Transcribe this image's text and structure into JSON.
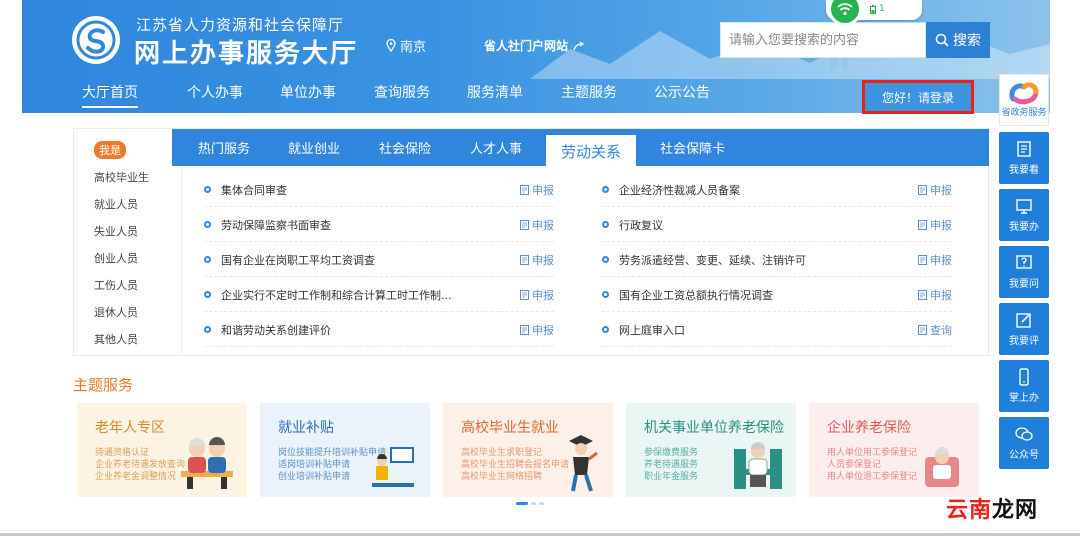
{
  "header": {
    "org_name": "江苏省人力资源和社会保障厅",
    "site_title": "网上办事服务大厅",
    "city": "南京",
    "portal_link": "省人社门户网站",
    "search": {
      "placeholder": "请输入您要搜索的内容",
      "button_label": "搜索"
    },
    "login_label": "您好！请登录"
  },
  "status_popup": {
    "battery_text": "1"
  },
  "nav": {
    "items": [
      {
        "label": "大厅首页",
        "active": true
      },
      {
        "label": "个人办事"
      },
      {
        "label": "单位办事"
      },
      {
        "label": "查询服务"
      },
      {
        "label": "服务清单"
      },
      {
        "label": "主题服务"
      },
      {
        "label": "公示公告"
      }
    ]
  },
  "side_bar": {
    "top_label": "省政务服务",
    "items": [
      {
        "label": "我要看",
        "icon": "book-icon"
      },
      {
        "label": "我要办",
        "icon": "monitor-icon"
      },
      {
        "label": "我要问",
        "icon": "question-icon"
      },
      {
        "label": "我要评",
        "icon": "edit-icon"
      },
      {
        "label": "掌上办",
        "icon": "phone-icon"
      },
      {
        "label": "公众号",
        "icon": "wechat-icon"
      }
    ]
  },
  "persona": {
    "badge": "我是",
    "items": [
      "高校毕业生",
      "就业人员",
      "失业人员",
      "创业人员",
      "工伤人员",
      "退休人员",
      "其他人员"
    ]
  },
  "tabs": {
    "items": [
      {
        "label": "热门服务"
      },
      {
        "label": "就业创业"
      },
      {
        "label": "社会保险"
      },
      {
        "label": "人才人事"
      },
      {
        "label": "劳动关系",
        "active": true
      },
      {
        "label": "社会保障卡"
      }
    ]
  },
  "services": {
    "left": [
      {
        "title": "集体合同审查",
        "action": "申报"
      },
      {
        "title": "劳动保障监察书面审查",
        "action": "申报"
      },
      {
        "title": "国有企业在岗职工平均工资调查",
        "action": "申报"
      },
      {
        "title": "企业实行不定时工作制和综合计算工时工作制...",
        "action": "申报"
      },
      {
        "title": "和谐劳动关系创建评价",
        "action": "申报"
      }
    ],
    "right": [
      {
        "title": "企业经济性裁减人员备案",
        "action": "申报"
      },
      {
        "title": "行政复议",
        "action": "申报"
      },
      {
        "title": "劳务派遣经营、变更、延续、注销许可",
        "action": "申报"
      },
      {
        "title": "国有企业工资总额执行情况调查",
        "action": "申报"
      },
      {
        "title": "网上庭审入口",
        "action": "查询"
      }
    ]
  },
  "themes": {
    "title": "主题服务",
    "cards": [
      {
        "title": "老年人专区",
        "lines": [
          "待遇资格认证",
          "企业养老待遇发放查询",
          "企业养老金调整情况"
        ],
        "bg": "#fdf3e3",
        "title_color": "#d9892f",
        "line_color": "#d9a05a"
      },
      {
        "title": "就业补贴",
        "lines": [
          "岗位技能提升培训补贴申请",
          "适岗培训补贴申请",
          "创业培训补贴申请"
        ],
        "bg": "#eaf3fc",
        "title_color": "#2d6fb3",
        "line_color": "#5a8fc6"
      },
      {
        "title": "高校毕业生就业",
        "lines": [
          "高校毕业生求职登记",
          "高校毕业生招聘会报名申请",
          "高校毕业生网络招聘"
        ],
        "bg": "#fdf0e8",
        "title_color": "#e0672c",
        "line_color": "#e49a6e"
      },
      {
        "title": "机关事业单位养老保险",
        "lines": [
          "参保缴费服务",
          "养老待遇服务",
          "职业年金服务"
        ],
        "bg": "#e9f6f4",
        "title_color": "#2c8f86",
        "line_color": "#5aaea5"
      },
      {
        "title": "企业养老保险",
        "lines": [
          "用人单位用工参保登记",
          "人员参保登记",
          "用人单位退工参保登记"
        ],
        "bg": "#fdeeee",
        "title_color": "#e0595b",
        "line_color": "#e88789"
      }
    ]
  },
  "watermark": {
    "part1": "云南",
    "part2": "龙网"
  },
  "colors": {
    "primary": "#2f86dc",
    "accent_orange": "#e77a2e",
    "login_border": "#e8211b"
  }
}
